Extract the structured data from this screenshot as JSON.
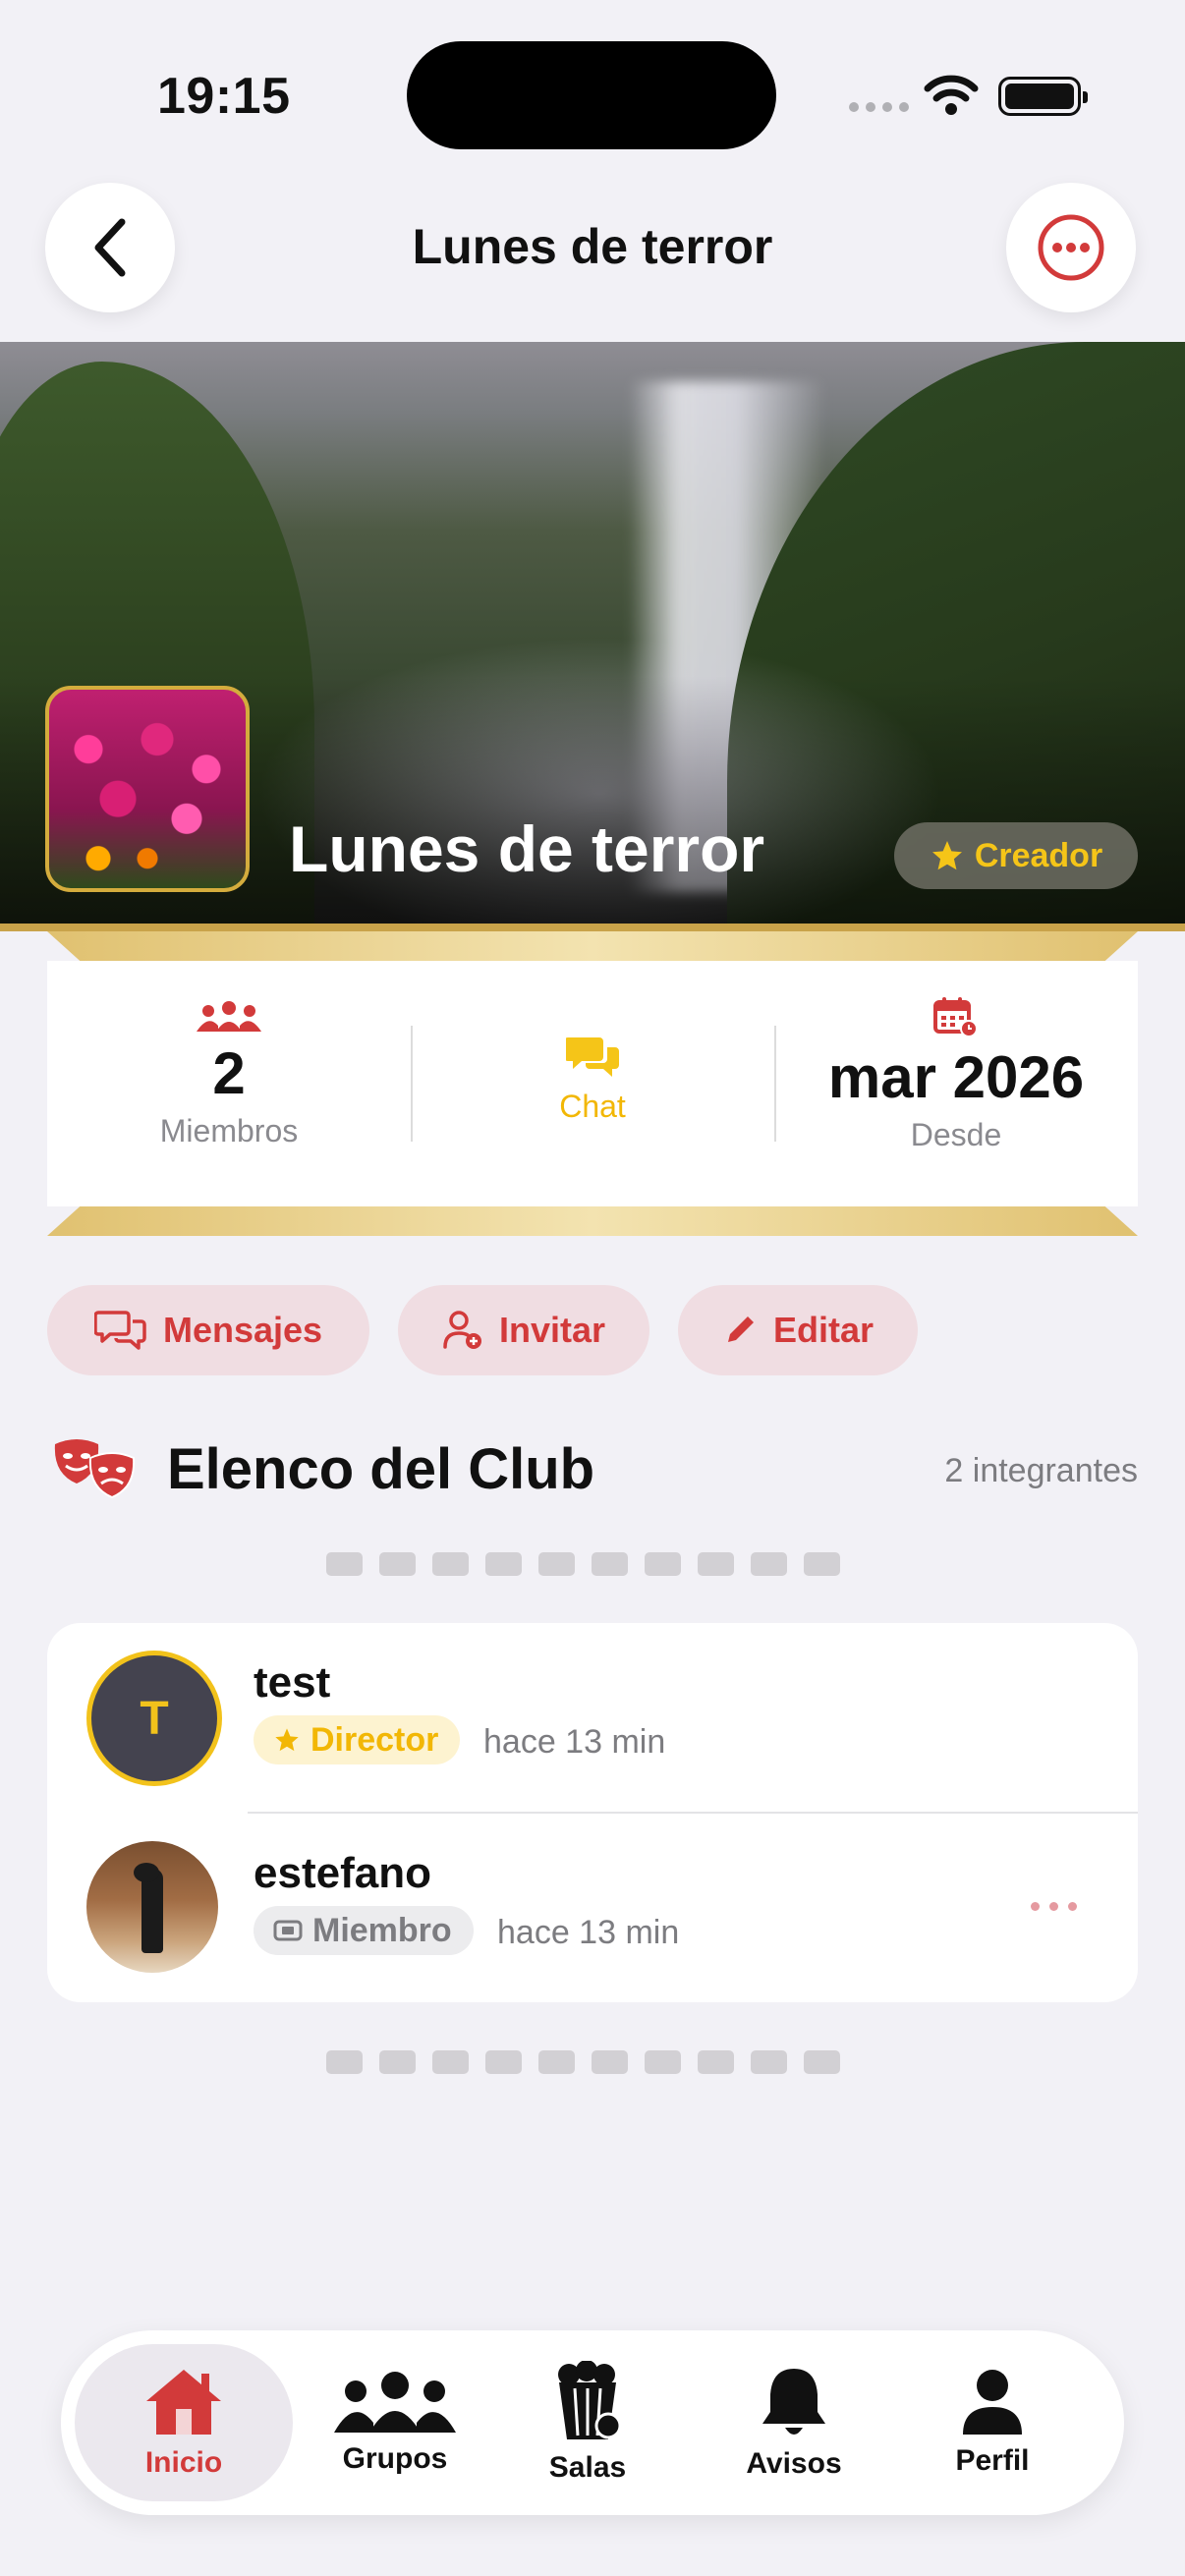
{
  "status_bar": {
    "time": "19:15"
  },
  "nav": {
    "title": "Lunes de terror"
  },
  "hero": {
    "title": "Lunes de terror",
    "badge": "Creador"
  },
  "stats": {
    "members_value": "2",
    "members_label": "Miembros",
    "chat_label": "Chat",
    "since_value": "mar 2026",
    "since_label": "Desde"
  },
  "actions": {
    "messages": "Mensajes",
    "invite": "Invitar",
    "edit": "Editar"
  },
  "cast": {
    "title": "Elenco del Club",
    "count": "2 integrantes",
    "members": [
      {
        "initial": "T",
        "name": "test",
        "role": "Director",
        "time": "hace 13 min"
      },
      {
        "name": "estefano",
        "role": "Miembro",
        "time": "hace 13 min"
      }
    ]
  },
  "tabs": [
    {
      "label": "Inicio",
      "active": true
    },
    {
      "label": "Grupos"
    },
    {
      "label": "Salas"
    },
    {
      "label": "Avisos"
    },
    {
      "label": "Perfil"
    }
  ],
  "colors": {
    "accent": "#d23a3a",
    "gold": "#f2c21b",
    "background": "#f2f1f6"
  }
}
